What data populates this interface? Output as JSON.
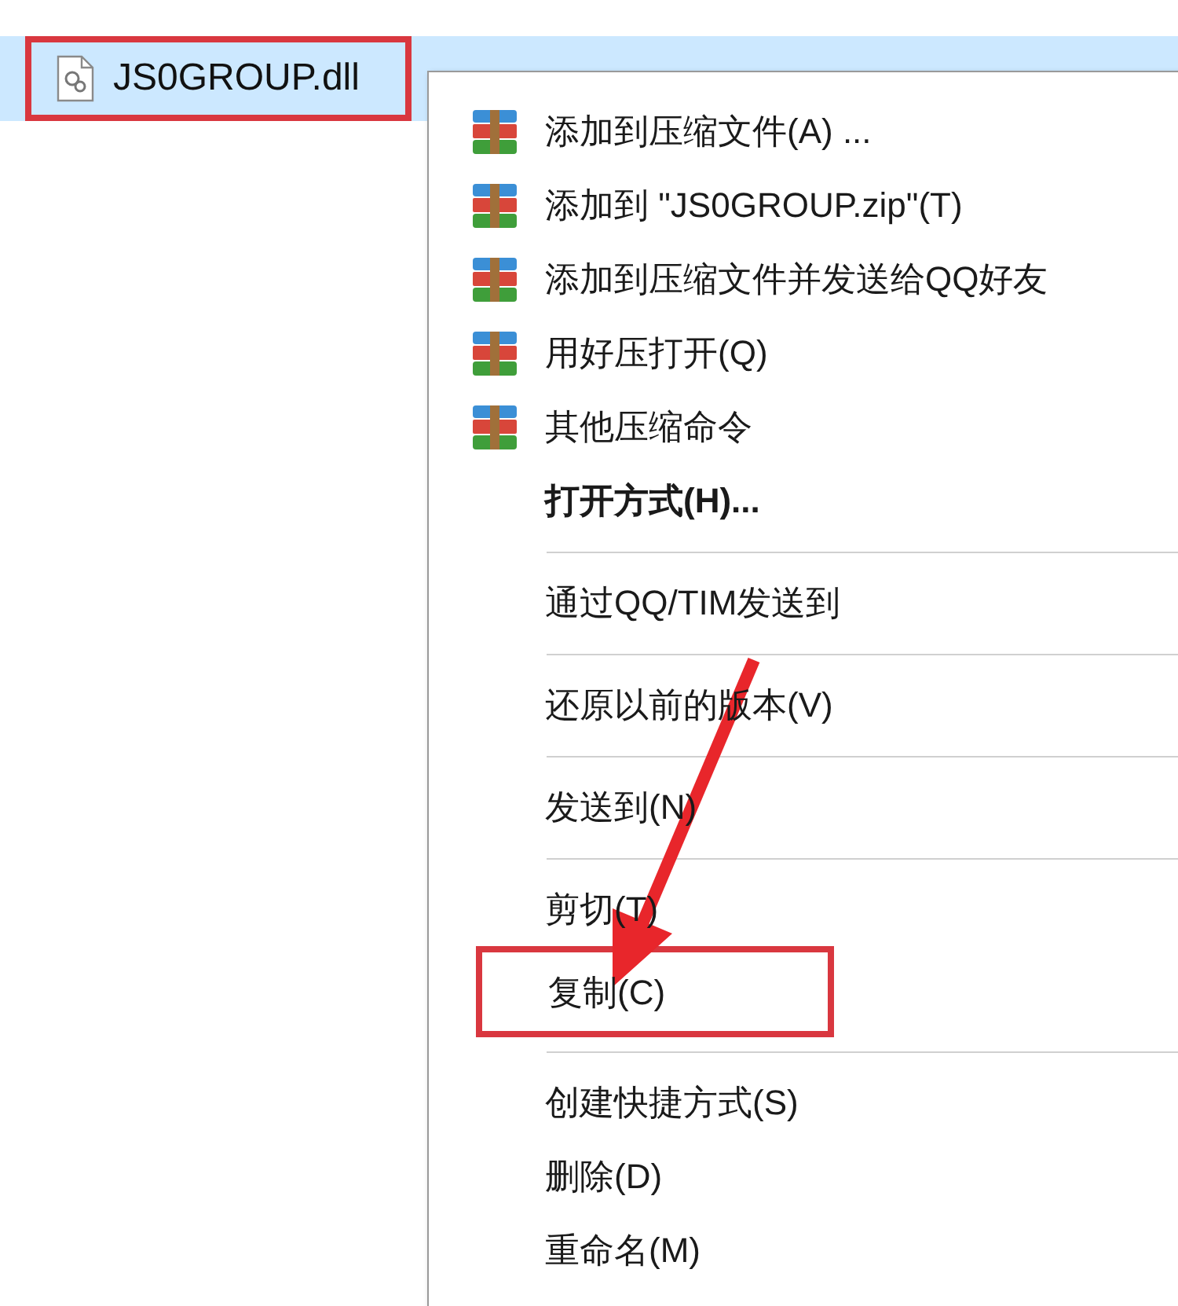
{
  "file": {
    "name": "JS0GROUP.dll",
    "selected": true,
    "highlighted": true
  },
  "context_menu": {
    "items": [
      {
        "kind": "archive",
        "label": "添加到压缩文件(A) ...",
        "bold": false,
        "separator_before": false,
        "highlighted": false
      },
      {
        "kind": "archive",
        "label": "添加到 \"JS0GROUP.zip\"(T)",
        "bold": false,
        "separator_before": false,
        "highlighted": false
      },
      {
        "kind": "archive",
        "label": "添加到压缩文件并发送给QQ好友",
        "bold": false,
        "separator_before": false,
        "highlighted": false
      },
      {
        "kind": "archive",
        "label": "用好压打开(Q)",
        "bold": false,
        "separator_before": false,
        "highlighted": false
      },
      {
        "kind": "archive",
        "label": "其他压缩命令",
        "bold": false,
        "separator_before": false,
        "highlighted": false
      },
      {
        "kind": "plain",
        "label": "打开方式(H)...",
        "bold": true,
        "separator_before": false,
        "highlighted": false
      },
      {
        "kind": "plain",
        "label": "通过QQ/TIM发送到",
        "bold": false,
        "separator_before": true,
        "highlighted": false
      },
      {
        "kind": "plain",
        "label": "还原以前的版本(V)",
        "bold": false,
        "separator_before": true,
        "highlighted": false
      },
      {
        "kind": "plain",
        "label": "发送到(N)",
        "bold": false,
        "separator_before": true,
        "highlighted": false
      },
      {
        "kind": "plain",
        "label": "剪切(T)",
        "bold": false,
        "separator_before": true,
        "highlighted": false
      },
      {
        "kind": "plain",
        "label": "复制(C)",
        "bold": false,
        "separator_before": false,
        "highlighted": true
      },
      {
        "kind": "plain",
        "label": "创建快捷方式(S)",
        "bold": false,
        "separator_before": true,
        "highlighted": false
      },
      {
        "kind": "plain",
        "label": "删除(D)",
        "bold": false,
        "separator_before": false,
        "highlighted": false
      },
      {
        "kind": "plain",
        "label": "重命名(M)",
        "bold": false,
        "separator_before": false,
        "highlighted": false
      }
    ]
  }
}
